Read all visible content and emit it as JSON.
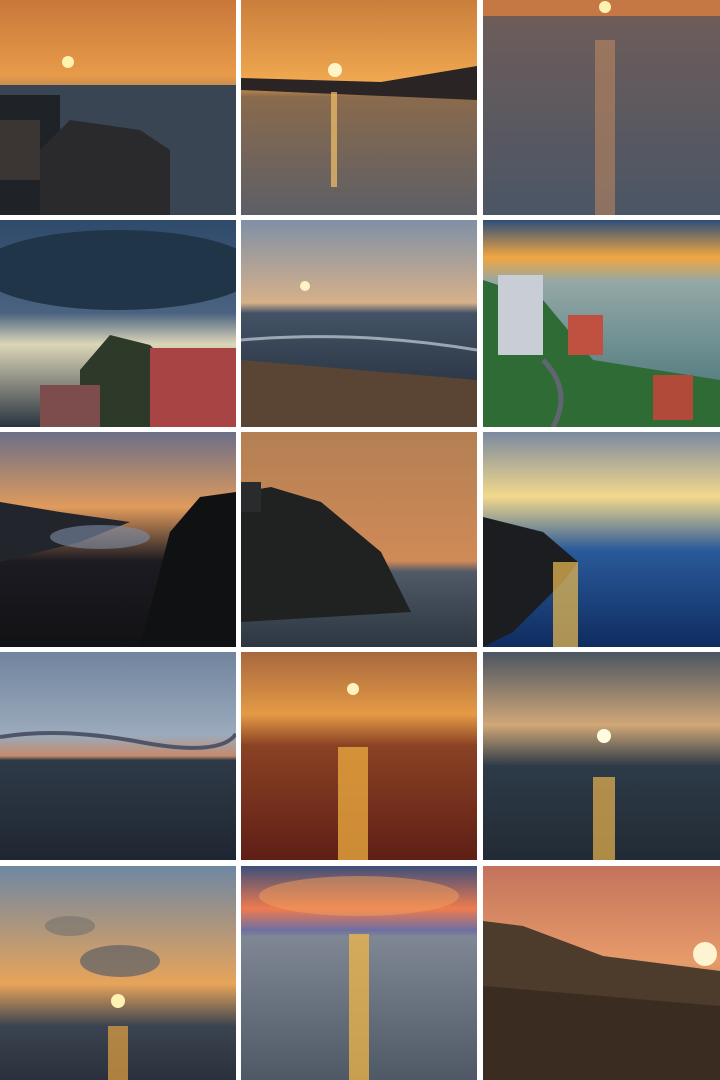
{
  "gallery": {
    "tiles": [
      {
        "subject": "sunset-over-sea-with-coastal-buildings"
      },
      {
        "subject": "sun-low-over-calm-bay-with-bird"
      },
      {
        "subject": "sun-reflection-path-on-open-sea"
      },
      {
        "subject": "storm-clouds-over-coastal-town"
      },
      {
        "subject": "sunrise-over-beach-waves"
      },
      {
        "subject": "aerial-coastal-road-and-buildings"
      },
      {
        "subject": "dusk-silhouette-of-hills-and-bay"
      },
      {
        "subject": "rocky-headland-silhouette"
      },
      {
        "subject": "sunlit-cliff-reflection-blue-sky"
      },
      {
        "subject": "calm-sea-at-twilight"
      },
      {
        "subject": "orange-sunset-sea-reflection"
      },
      {
        "subject": "sun-through-clouds-over-sea"
      },
      {
        "subject": "cloudy-sky-with-sun-on-horizon"
      },
      {
        "subject": "colorful-clouds-sun-reflection"
      },
      {
        "subject": "sun-flare-over-hillside"
      }
    ]
  }
}
